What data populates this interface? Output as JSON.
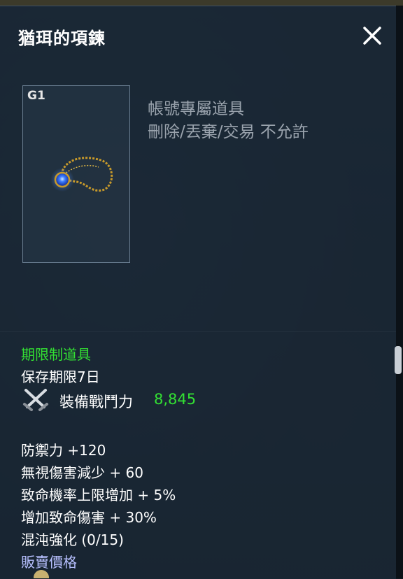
{
  "window": {
    "title": "猶珥的項鍊",
    "close_icon": "close-icon"
  },
  "item": {
    "grade": "G1",
    "icon": "necklace-icon",
    "bind_text": "帳號專屬道具",
    "restriction_text": "刪除/丟棄/交易 不允許"
  },
  "details": {
    "limited_label": "期限制道具",
    "period_label": "保存期限7日",
    "power_icon": "crossed-swords-icon",
    "power_label": "裝備戰鬥力",
    "power_value": "8,845",
    "stats": [
      "防禦力 +120",
      "無視傷害減少 + 60",
      "致命機率上限增加 +  5%",
      "增加致命傷害 + 30%",
      "混沌強化 (0/15)"
    ],
    "sell_label": "販賣價格"
  },
  "colors": {
    "highlight_green": "#33e033",
    "panel_bg": "#1a2836",
    "sell_label": "#b7c0ff",
    "desc_gray": "#9aa3ad"
  }
}
